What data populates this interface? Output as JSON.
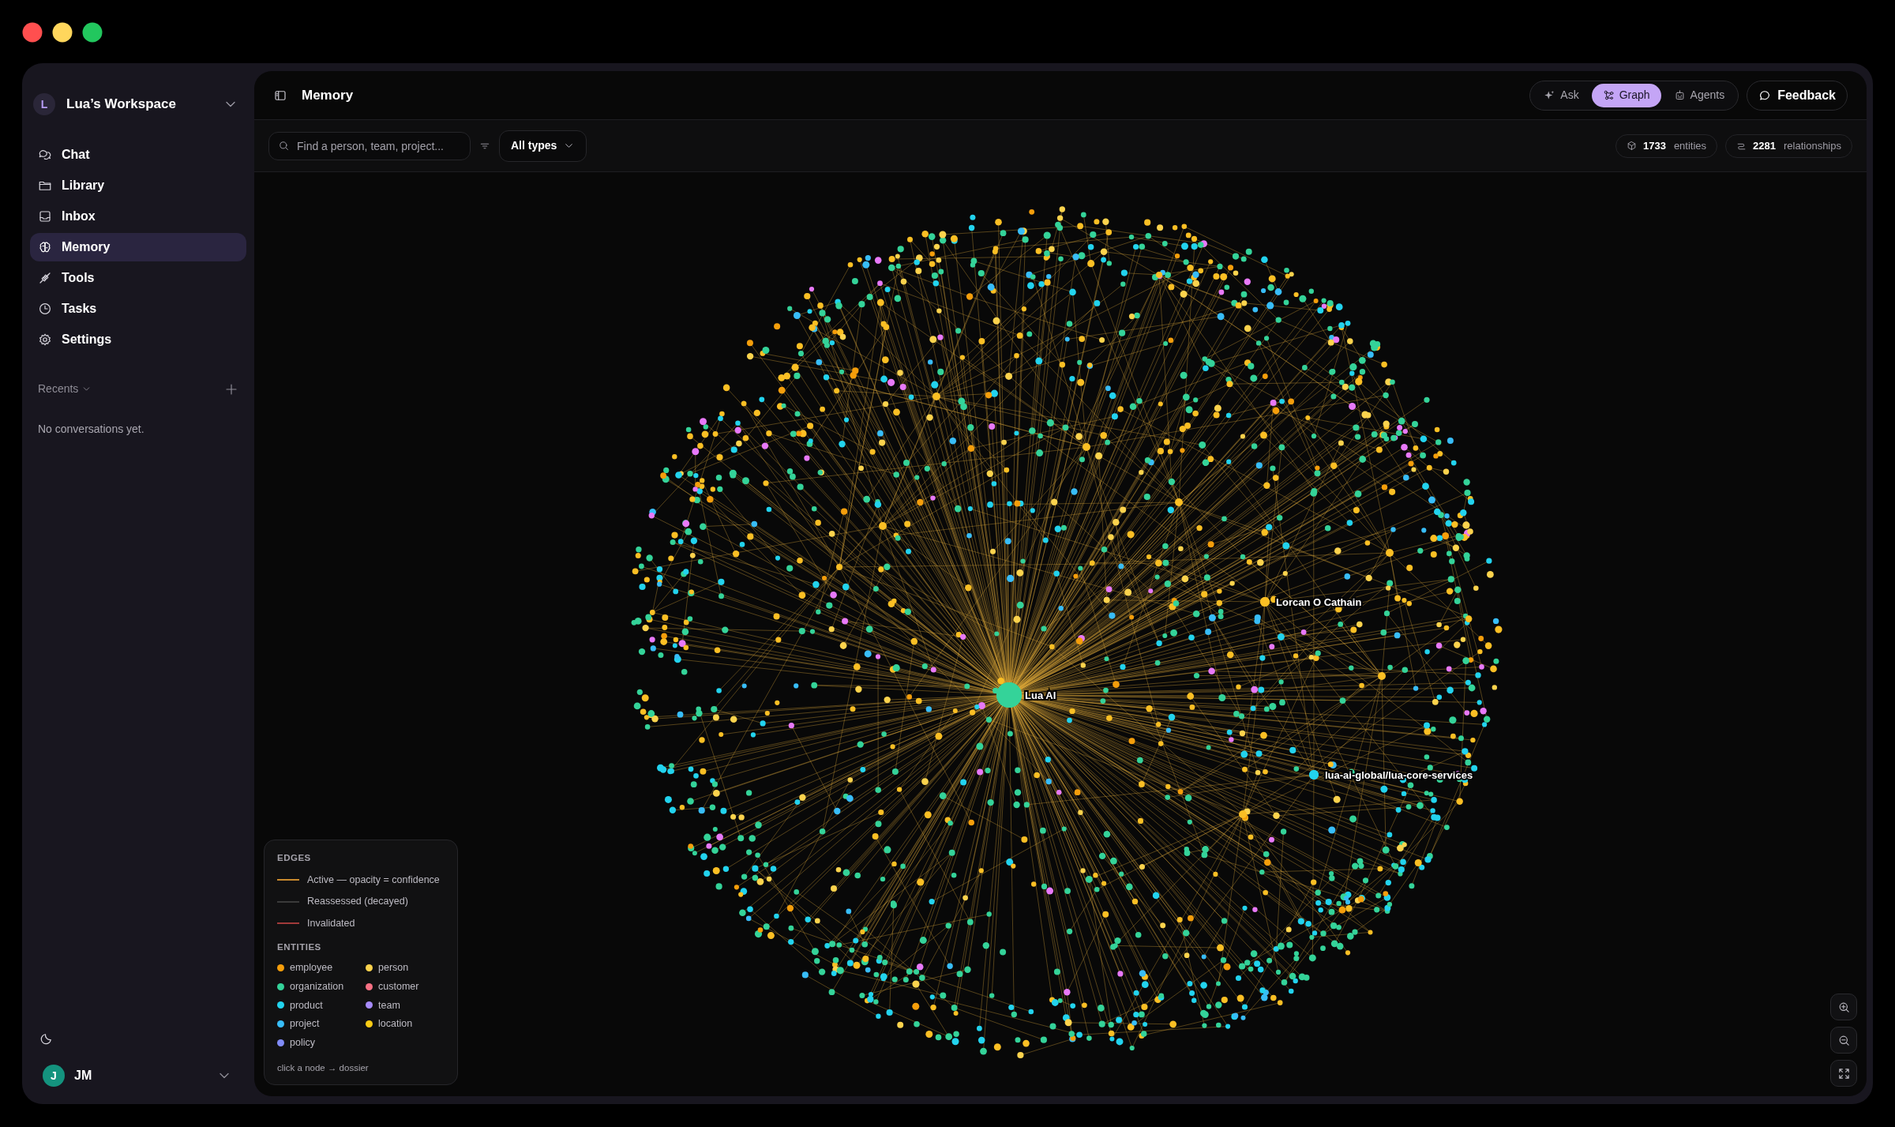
{
  "sidebar": {
    "workspace": {
      "avatar": "L",
      "name": "Lua’s Workspace"
    },
    "nav": [
      {
        "label": "Chat",
        "selected": false
      },
      {
        "label": "Library",
        "selected": false
      },
      {
        "label": "Inbox",
        "selected": false
      },
      {
        "label": "Memory",
        "selected": true
      },
      {
        "label": "Tools",
        "selected": false
      },
      {
        "label": "Tasks",
        "selected": false
      },
      {
        "label": "Settings",
        "selected": false
      }
    ],
    "recents": {
      "label": "Recents",
      "empty": "No conversations yet."
    },
    "user": {
      "avatar": "J",
      "name": "JM"
    }
  },
  "header": {
    "title": "Memory",
    "view_tabs": [
      {
        "label": "Ask",
        "selected": false
      },
      {
        "label": "Graph",
        "selected": true
      },
      {
        "label": "Agents",
        "selected": false
      }
    ],
    "feedback": "Feedback"
  },
  "toolbar": {
    "search": {
      "placeholder": "Find a person, team, project..."
    },
    "type_filter": "All types",
    "stats": [
      {
        "kind": "entities",
        "value": "1733",
        "label": "entities"
      },
      {
        "kind": "relationships",
        "value": "2281",
        "label": "relationships"
      }
    ]
  },
  "graph": {
    "node_labels": [
      {
        "text": "Lua AI",
        "color": "#34d399"
      },
      {
        "text": "Lorcan O Cathain",
        "color": "#fbbf24"
      },
      {
        "text": "lua-ai-global/lua-core-services",
        "color": "#22d3ee"
      }
    ]
  },
  "legend": {
    "edges_title": "EDGES",
    "edges": [
      {
        "label": "Active — opacity = confidence",
        "color": "#c98a2e"
      },
      {
        "label": "Reassessed (decayed)",
        "color": "#3a3a3a"
      },
      {
        "label": "Invalidated",
        "color": "#a13a3a"
      }
    ],
    "entities_title": "ENTITIES",
    "entities": [
      {
        "label": "employee",
        "color": "#f59e0b"
      },
      {
        "label": "person",
        "color": "#fcd34d"
      },
      {
        "label": "organization",
        "color": "#34d399"
      },
      {
        "label": "customer",
        "color": "#f87184"
      },
      {
        "label": "product",
        "color": "#22d3ee"
      },
      {
        "label": "team",
        "color": "#a78bfa"
      },
      {
        "label": "project",
        "color": "#38bdf8"
      },
      {
        "label": "location",
        "color": "#facc15"
      },
      {
        "label": "policy",
        "color": "#818cf8"
      }
    ],
    "hint": "click a node → dossier"
  }
}
